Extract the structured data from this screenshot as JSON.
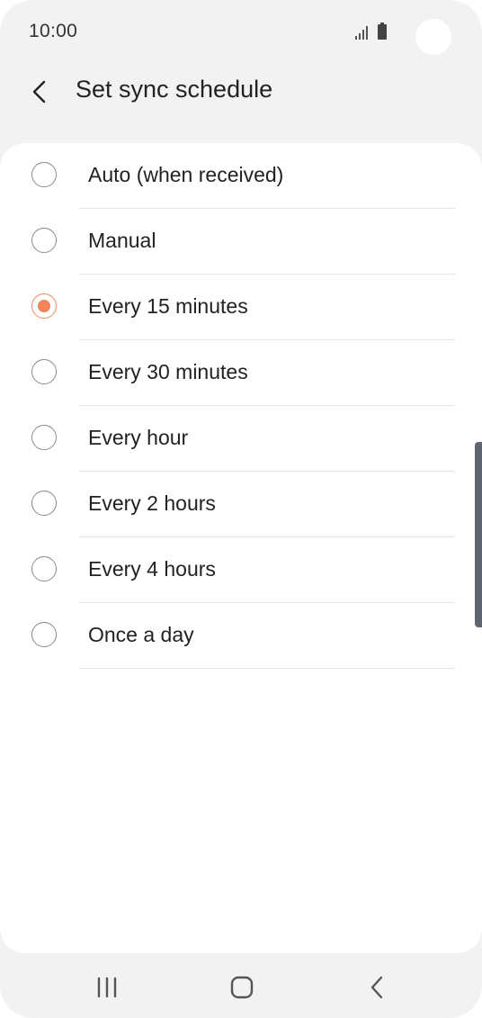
{
  "status_bar": {
    "time": "10:00"
  },
  "header": {
    "title": "Set sync schedule",
    "back_icon": "chevron-left-icon"
  },
  "options": [
    {
      "label": "Auto (when received)",
      "selected": false
    },
    {
      "label": "Manual",
      "selected": false
    },
    {
      "label": "Every 15 minutes",
      "selected": true
    },
    {
      "label": "Every 30 minutes",
      "selected": false
    },
    {
      "label": "Every hour",
      "selected": false
    },
    {
      "label": "Every 2 hours",
      "selected": false
    },
    {
      "label": "Every 4 hours",
      "selected": false
    },
    {
      "label": "Once a day",
      "selected": false
    }
  ],
  "nav_bar": {
    "recents_icon": "recents-icon",
    "home_icon": "home-icon",
    "back_icon": "back-icon"
  },
  "colors": {
    "accent": "#f2845a",
    "background": "#f2f2f2",
    "card": "#ffffff",
    "text": "#222222"
  }
}
